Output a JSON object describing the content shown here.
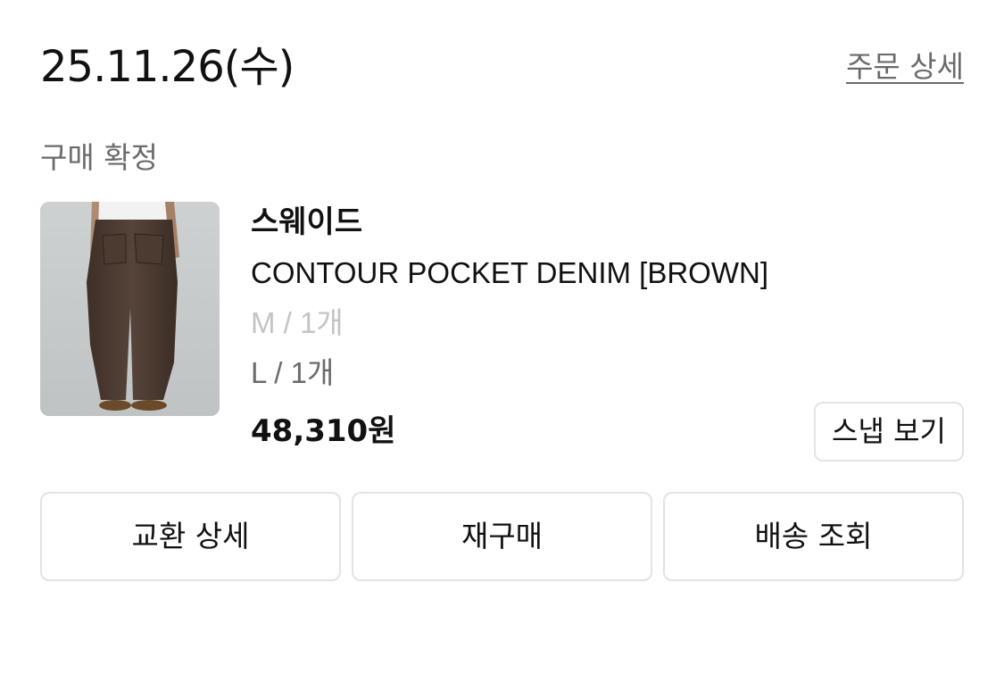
{
  "order": {
    "date": "25.11.26(수)",
    "detail_link": "주문 상세",
    "status": "구매 확정"
  },
  "product": {
    "brand": "스웨이드",
    "name": "CONTOUR POCKET DENIM [BROWN]",
    "options": [
      "M / 1개",
      "L / 1개"
    ],
    "price": "48,310원",
    "snap_button": "스냅 보기",
    "image_icon": "product-photo-brown-denim"
  },
  "actions": {
    "exchange": "교환 상세",
    "reorder": "재구매",
    "tracking": "배송 조회"
  },
  "colors": {
    "muted_text": "#6b6b6b",
    "disabled_text": "#c4c4c4",
    "border": "#e3e3e3"
  }
}
